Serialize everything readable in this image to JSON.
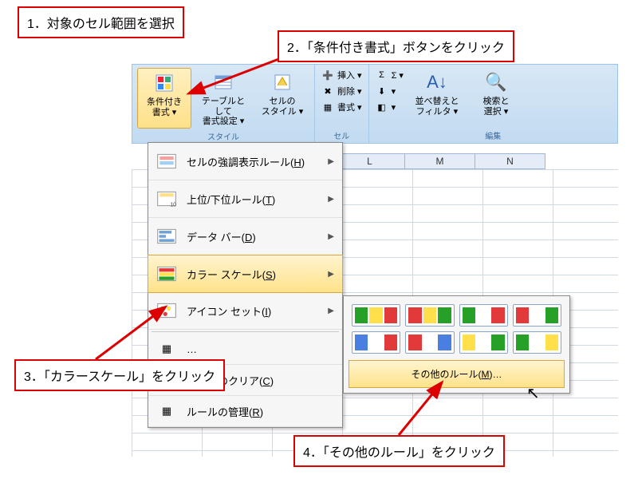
{
  "callouts": {
    "c1": "1．対象のセル範囲を選択",
    "c2": "2．「条件付き書式」ボタンをクリック",
    "c3": "3．「カラースケール」をクリック",
    "c4": "4．「その他のルール」をクリック"
  },
  "ribbon": {
    "styles": {
      "cond": "条件付き\n書式 ▾",
      "table": "テーブルとして\n書式設定 ▾",
      "cell": "セルの\nスタイル ▾",
      "group": "スタイル"
    },
    "cells": {
      "insert": "挿入 ▾",
      "delete": "削除 ▾",
      "format": "書式 ▾",
      "group": "セル"
    },
    "editing": {
      "sigma": "Σ ▾",
      "fill": "▾",
      "clear": "▾",
      "sort": "並べ替えと\nフィルタ ▾",
      "find": "検索と\n選択 ▾",
      "group": "編集"
    }
  },
  "columns": [
    "L",
    "M",
    "N"
  ],
  "dropdown": {
    "items": [
      {
        "label": "セルの強調表示ルール(H)",
        "u": "H",
        "icon": "highlight"
      },
      {
        "label": "上位/下位ルール(T)",
        "u": "T",
        "icon": "topbottom"
      },
      {
        "label": "データ バー(D)",
        "u": "D",
        "icon": "databar"
      },
      {
        "label": "カラー スケール(S)",
        "u": "S",
        "icon": "colorscale",
        "hover": true
      },
      {
        "label": "アイコン セット(I)",
        "u": "I",
        "icon": "iconset"
      }
    ],
    "secondary": [
      {
        "label": "ルールのクリア(C)",
        "u": "C"
      },
      {
        "label": "ルールの管理(R)",
        "u": "R"
      }
    ],
    "hidden_line": "…"
  },
  "submenu": {
    "swatches": [
      [
        "#26a026",
        "#ffe04a",
        "#e23a3a"
      ],
      [
        "#e23a3a",
        "#ffe04a",
        "#26a026"
      ],
      [
        "#26a026",
        "#fff",
        "#e23a3a"
      ],
      [
        "#e23a3a",
        "#fff",
        "#26a026"
      ],
      [
        "#4a7fe2",
        "#fff",
        "#e23a3a"
      ],
      [
        "#e23a3a",
        "#fff",
        "#4a7fe2"
      ],
      [
        "#ffe04a",
        "#fff",
        "#26a026"
      ],
      [
        "#26a026",
        "#fff",
        "#ffe04a"
      ]
    ],
    "more": "その他のルール(M)…",
    "more_u": "M"
  }
}
